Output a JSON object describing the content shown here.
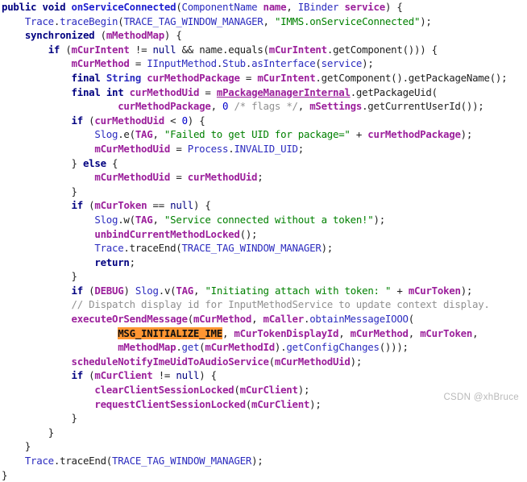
{
  "viewer": {
    "language": "java",
    "background": "#ffffff",
    "highlight_color": "#ff9632",
    "watermark": "CSDN @xhBruce"
  },
  "colors": {
    "keyword": "#000080",
    "method_declaration": "#2020d0",
    "type": "#2b2bbf",
    "field": "#9b1f9b",
    "string": "#008000",
    "comment": "#909090",
    "number": "#0000cc",
    "punctuation": "#202020",
    "highlight_background": "#ff9632",
    "watermark": "#b9b9b9"
  },
  "code": {
    "lines": [
      "public void onServiceConnected(ComponentName name, IBinder service) {",
      "    Trace.traceBegin(TRACE_TAG_WINDOW_MANAGER, \"IMMS.onServiceConnected\");",
      "    synchronized (mMethodMap) {",
      "        if (mCurIntent != null && name.equals(mCurIntent.getComponent())) {",
      "            mCurMethod = IInputMethod.Stub.asInterface(service);",
      "            final String curMethodPackage = mCurIntent.getComponent().getPackageName();",
      "            final int curMethodUid = mPackageManagerInternal.getPackageUid(",
      "                    curMethodPackage, 0 /* flags */, mSettings.getCurrentUserId());",
      "            if (curMethodUid < 0) {",
      "                Slog.e(TAG, \"Failed to get UID for package=\" + curMethodPackage);",
      "                mCurMethodUid = Process.INVALID_UID;",
      "            } else {",
      "                mCurMethodUid = curMethodUid;",
      "            }",
      "            if (mCurToken == null) {",
      "                Slog.w(TAG, \"Service connected without a token!\");",
      "                unbindCurrentMethodLocked();",
      "                Trace.traceEnd(TRACE_TAG_WINDOW_MANAGER);",
      "                return;",
      "            }",
      "            if (DEBUG) Slog.v(TAG, \"Initiating attach with token: \" + mCurToken);",
      "            // Dispatch display id for InputMethodService to update context display.",
      "            executeOrSendMessage(mCurMethod, mCaller.obtainMessageIOOO(",
      "                    MSG_INITIALIZE_IME, mCurTokenDisplayId, mCurMethod, mCurToken,",
      "                    mMethodMap.get(mCurMethodId).getConfigChanges()));",
      "            scheduleNotifyImeUidToAudioService(mCurMethodUid);",
      "            if (mCurClient != null) {",
      "                clearClientSessionLocked(mCurClient);",
      "                requestClientSessionLocked(mCurClient);",
      "            }",
      "        }",
      "    }",
      "    Trace.traceEnd(TRACE_TAG_WINDOW_MANAGER);",
      "}"
    ],
    "highlighted_token": "MSG_INITIALIZE_IME",
    "method_name": "onServiceConnected",
    "class_reference": "IMMS"
  }
}
